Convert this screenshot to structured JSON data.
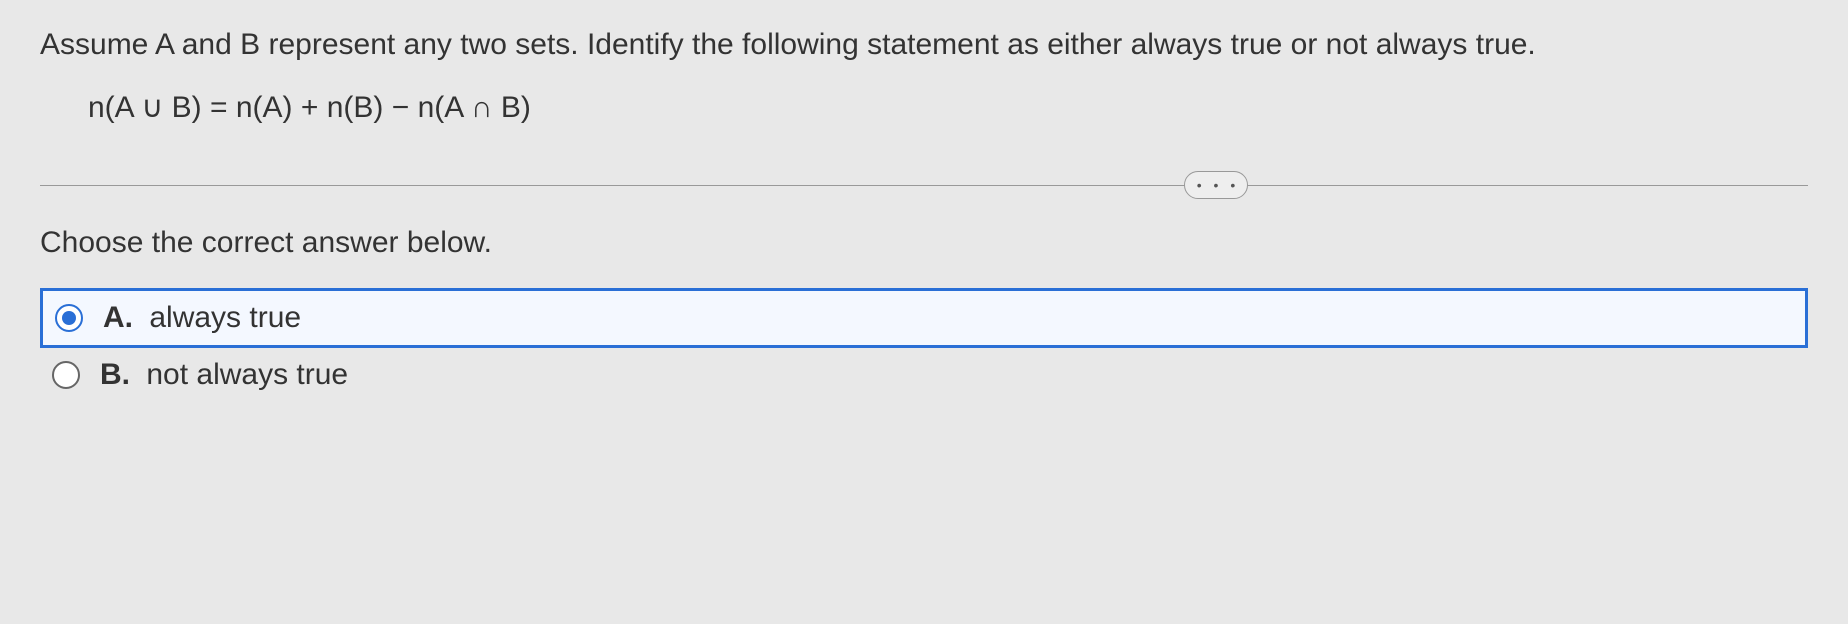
{
  "question": {
    "text": "Assume A and B represent any two sets. Identify the following statement as either always true or not always true.",
    "formula": "n(A ∪ B) = n(A) + n(B) − n(A ∩ B)"
  },
  "prompt": "Choose the correct answer below.",
  "choices": [
    {
      "letter": "A.",
      "text": "always true",
      "selected": true
    },
    {
      "letter": "B.",
      "text": "not always true",
      "selected": false
    }
  ],
  "more_dots": "• • •"
}
